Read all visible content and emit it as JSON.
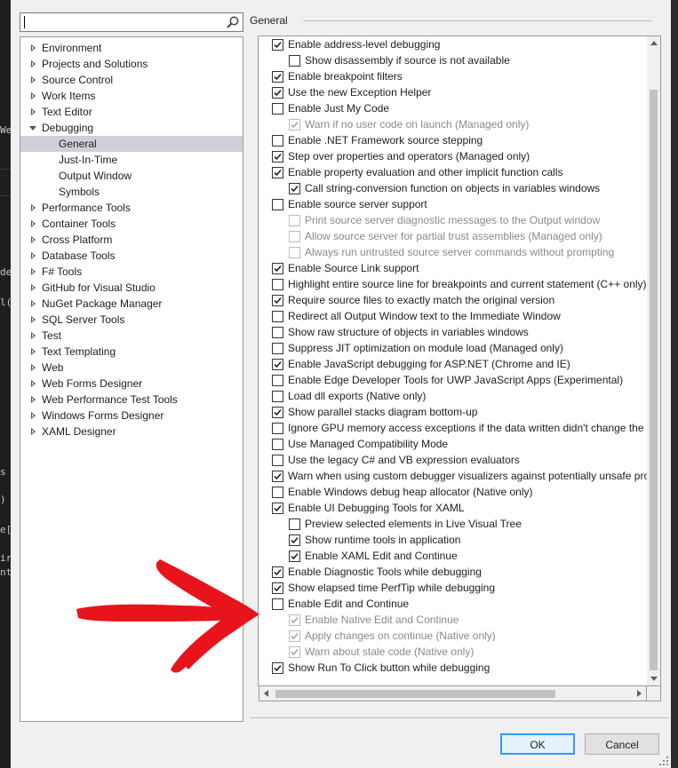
{
  "search": {
    "value": "",
    "placeholder": ""
  },
  "tree": [
    {
      "label": "Environment",
      "level": 0,
      "expander": "collapsed"
    },
    {
      "label": "Projects and Solutions",
      "level": 0,
      "expander": "collapsed"
    },
    {
      "label": "Source Control",
      "level": 0,
      "expander": "collapsed"
    },
    {
      "label": "Work Items",
      "level": 0,
      "expander": "collapsed"
    },
    {
      "label": "Text Editor",
      "level": 0,
      "expander": "collapsed"
    },
    {
      "label": "Debugging",
      "level": 0,
      "expander": "expanded"
    },
    {
      "label": "General",
      "level": 1,
      "selected": true
    },
    {
      "label": "Just-In-Time",
      "level": 1
    },
    {
      "label": "Output Window",
      "level": 1
    },
    {
      "label": "Symbols",
      "level": 1
    },
    {
      "label": "Performance Tools",
      "level": 0,
      "expander": "collapsed"
    },
    {
      "label": "Container Tools",
      "level": 0,
      "expander": "collapsed"
    },
    {
      "label": "Cross Platform",
      "level": 0,
      "expander": "collapsed"
    },
    {
      "label": "Database Tools",
      "level": 0,
      "expander": "collapsed"
    },
    {
      "label": "F# Tools",
      "level": 0,
      "expander": "collapsed"
    },
    {
      "label": "GitHub for Visual Studio",
      "level": 0,
      "expander": "collapsed"
    },
    {
      "label": "NuGet Package Manager",
      "level": 0,
      "expander": "collapsed"
    },
    {
      "label": "SQL Server Tools",
      "level": 0,
      "expander": "collapsed"
    },
    {
      "label": "Test",
      "level": 0,
      "expander": "collapsed"
    },
    {
      "label": "Text Templating",
      "level": 0,
      "expander": "collapsed"
    },
    {
      "label": "Web",
      "level": 0,
      "expander": "collapsed"
    },
    {
      "label": "Web Forms Designer",
      "level": 0,
      "expander": "collapsed"
    },
    {
      "label": "Web Performance Test Tools",
      "level": 0,
      "expander": "collapsed"
    },
    {
      "label": "Windows Forms Designer",
      "level": 0,
      "expander": "collapsed"
    },
    {
      "label": "XAML Designer",
      "level": 0,
      "expander": "collapsed"
    }
  ],
  "group_title": "General",
  "options": [
    {
      "label": "Enable address-level debugging",
      "checked": true,
      "indent": 0,
      "enabled": true
    },
    {
      "label": "Show disassembly if source is not available",
      "checked": false,
      "indent": 1,
      "enabled": true
    },
    {
      "label": "Enable breakpoint filters",
      "checked": true,
      "indent": 0,
      "enabled": true
    },
    {
      "label": "Use the new Exception Helper",
      "checked": true,
      "indent": 0,
      "enabled": true
    },
    {
      "label": "Enable Just My Code",
      "checked": false,
      "indent": 0,
      "enabled": true
    },
    {
      "label": "Warn if no user code on launch (Managed only)",
      "checked": true,
      "indent": 1,
      "enabled": false
    },
    {
      "label": "Enable .NET Framework source stepping",
      "checked": false,
      "indent": 0,
      "enabled": true
    },
    {
      "label": "Step over properties and operators (Managed only)",
      "checked": true,
      "indent": 0,
      "enabled": true
    },
    {
      "label": "Enable property evaluation and other implicit function calls",
      "checked": true,
      "indent": 0,
      "enabled": true
    },
    {
      "label": "Call string-conversion function on objects in variables windows",
      "checked": true,
      "indent": 1,
      "enabled": true
    },
    {
      "label": "Enable source server support",
      "checked": false,
      "indent": 0,
      "enabled": true
    },
    {
      "label": "Print source server diagnostic messages to the Output window",
      "checked": false,
      "indent": 1,
      "enabled": false
    },
    {
      "label": "Allow source server for partial trust assemblies (Managed only)",
      "checked": false,
      "indent": 1,
      "enabled": false
    },
    {
      "label": "Always run untrusted source server commands without prompting",
      "checked": false,
      "indent": 1,
      "enabled": false
    },
    {
      "label": "Enable Source Link support",
      "checked": true,
      "indent": 0,
      "enabled": true
    },
    {
      "label": "Highlight entire source line for breakpoints and current statement (C++ only)",
      "checked": false,
      "indent": 0,
      "enabled": true
    },
    {
      "label": "Require source files to exactly match the original version",
      "checked": true,
      "indent": 0,
      "enabled": true
    },
    {
      "label": "Redirect all Output Window text to the Immediate Window",
      "checked": false,
      "indent": 0,
      "enabled": true
    },
    {
      "label": "Show raw structure of objects in variables windows",
      "checked": false,
      "indent": 0,
      "enabled": true
    },
    {
      "label": "Suppress JIT optimization on module load (Managed only)",
      "checked": false,
      "indent": 0,
      "enabled": true
    },
    {
      "label": "Enable JavaScript debugging for ASP.NET (Chrome and IE)",
      "checked": true,
      "indent": 0,
      "enabled": true
    },
    {
      "label": "Enable Edge Developer Tools for UWP JavaScript Apps (Experimental)",
      "checked": false,
      "indent": 0,
      "enabled": true
    },
    {
      "label": "Load dll exports (Native only)",
      "checked": false,
      "indent": 0,
      "enabled": true
    },
    {
      "label": "Show parallel stacks diagram bottom-up",
      "checked": true,
      "indent": 0,
      "enabled": true
    },
    {
      "label": "Ignore GPU memory access exceptions if the data written didn't change the v",
      "checked": false,
      "indent": 0,
      "enabled": true
    },
    {
      "label": "Use Managed Compatibility Mode",
      "checked": false,
      "indent": 0,
      "enabled": true
    },
    {
      "label": "Use the legacy C# and VB expression evaluators",
      "checked": false,
      "indent": 0,
      "enabled": true
    },
    {
      "label": "Warn when using custom debugger visualizers against potentially unsafe pro",
      "checked": true,
      "indent": 0,
      "enabled": true
    },
    {
      "label": "Enable Windows debug heap allocator (Native only)",
      "checked": false,
      "indent": 0,
      "enabled": true
    },
    {
      "label": "Enable UI Debugging Tools for XAML",
      "checked": true,
      "indent": 0,
      "enabled": true
    },
    {
      "label": "Preview selected elements in Live Visual Tree",
      "checked": false,
      "indent": 1,
      "enabled": true
    },
    {
      "label": "Show runtime tools in application",
      "checked": true,
      "indent": 1,
      "enabled": true
    },
    {
      "label": "Enable XAML Edit and Continue",
      "checked": true,
      "indent": 1,
      "enabled": true
    },
    {
      "label": "Enable Diagnostic Tools while debugging",
      "checked": true,
      "indent": 0,
      "enabled": true
    },
    {
      "label": "Show elapsed time PerfTip while debugging",
      "checked": true,
      "indent": 0,
      "enabled": true
    },
    {
      "label": "Enable Edit and Continue",
      "checked": false,
      "indent": 0,
      "enabled": true
    },
    {
      "label": "Enable Native Edit and Continue",
      "checked": true,
      "indent": 1,
      "enabled": false
    },
    {
      "label": "Apply changes on continue (Native only)",
      "checked": true,
      "indent": 1,
      "enabled": false
    },
    {
      "label": "Warn about stale code (Native only)",
      "checked": true,
      "indent": 1,
      "enabled": false
    },
    {
      "label": "Show Run To Click button while debugging",
      "checked": true,
      "indent": 0,
      "enabled": true
    }
  ],
  "buttons": {
    "ok": "OK",
    "cancel": "Cancel"
  },
  "background_code_fragments": [
    "We",
    "de",
    "l(",
    "s",
    ")",
    "e[",
    "ir",
    "nt"
  ],
  "colors": {
    "dialog_bg": "#f0f0f0",
    "tree_selected": "#cfcfd8",
    "ok_focus_border": "#3399ff",
    "annotation_arrow": "#e8141b",
    "editor_bg": "#1e1e1e"
  },
  "icons": {
    "search": "search-icon",
    "tree_expander": "triangle-right-icon",
    "tree_expanded": "triangle-down-icon",
    "checkbox": "checkmark-icon",
    "annotation": "red-hand-drawn-arrow-icon"
  }
}
